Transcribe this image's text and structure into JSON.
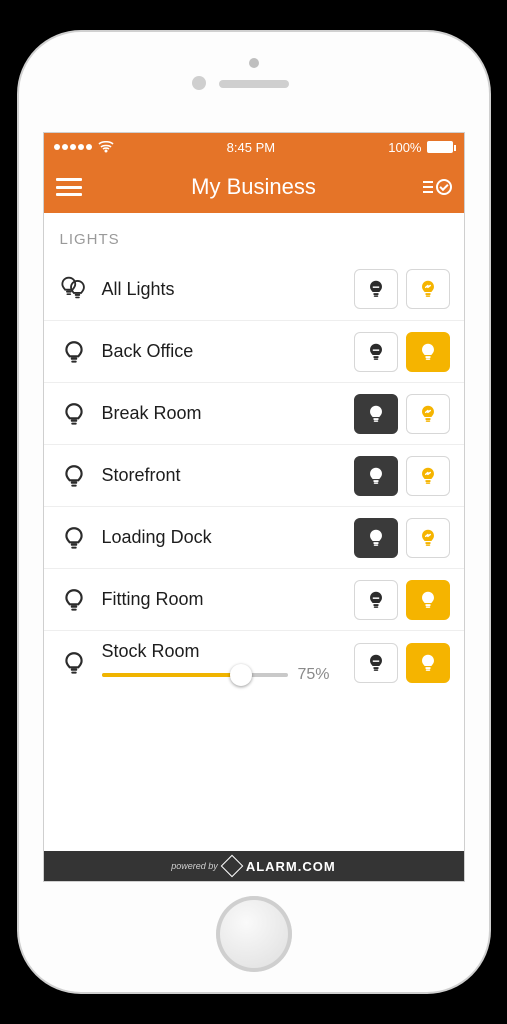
{
  "status": {
    "time": "8:45 PM",
    "battery": "100%"
  },
  "nav": {
    "title": "My Business"
  },
  "section": {
    "header": "LIGHTS"
  },
  "lights": [
    {
      "name": "All Lights",
      "icon": "double",
      "state": "neutral",
      "slider": null
    },
    {
      "name": "Back Office",
      "icon": "single",
      "state": "on",
      "slider": null
    },
    {
      "name": "Break Room",
      "icon": "single",
      "state": "off",
      "slider": null
    },
    {
      "name": "Storefront",
      "icon": "single",
      "state": "off",
      "slider": null
    },
    {
      "name": "Loading Dock",
      "icon": "single",
      "state": "off",
      "slider": null
    },
    {
      "name": "Fitting Room",
      "icon": "single",
      "state": "on",
      "slider": null
    },
    {
      "name": "Stock Room",
      "icon": "single",
      "state": "on",
      "slider": {
        "value": 75,
        "display": "75%"
      }
    }
  ],
  "footer": {
    "powered": "powered by",
    "brand": "ALARM.COM"
  },
  "colors": {
    "accent": "#e57428",
    "on": "#f5b400"
  }
}
